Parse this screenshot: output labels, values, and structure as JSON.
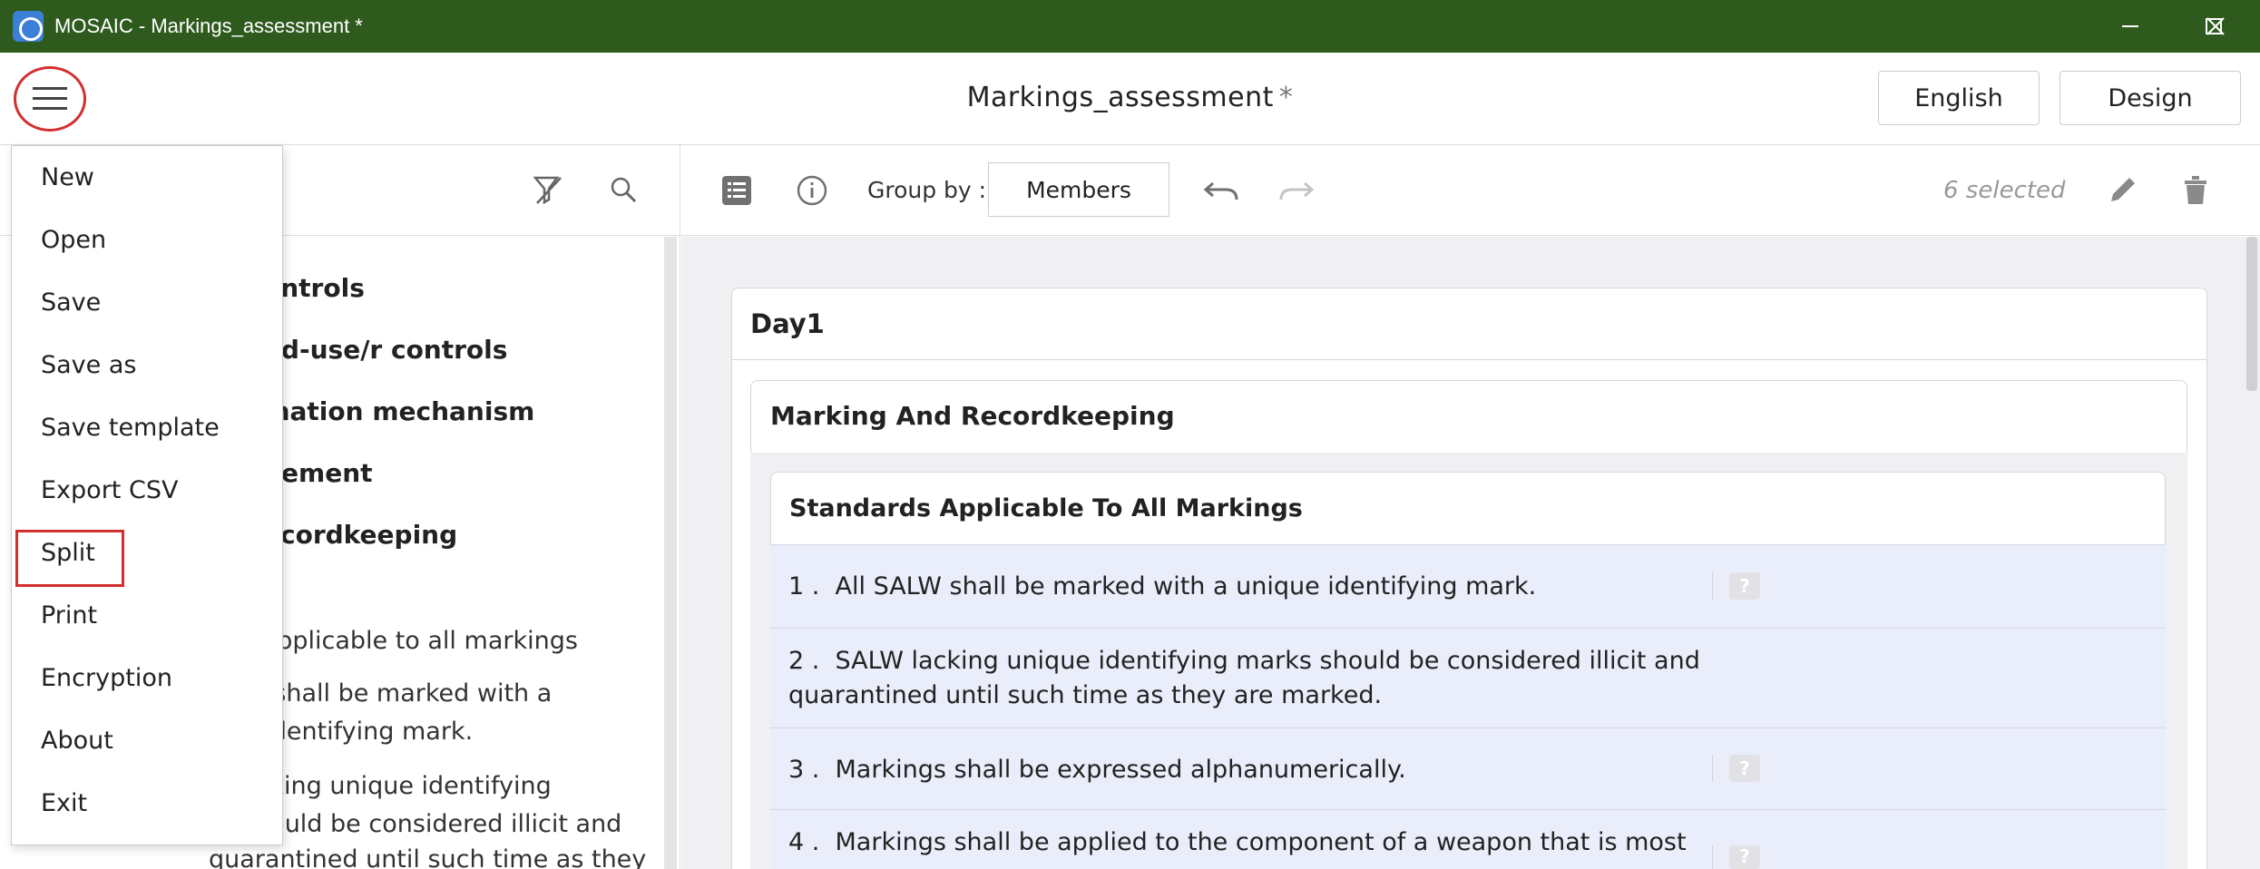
{
  "window": {
    "title": "MOSAIC - Markings_assessment *"
  },
  "header": {
    "title": "Markings_assessment",
    "modified_marker": "*",
    "language_button": "English",
    "design_button": "Design"
  },
  "menu": {
    "items": [
      "New",
      "Open",
      "Save",
      "Save as",
      "Save template",
      "Export CSV",
      "Split",
      "Print",
      "Encryption",
      "About",
      "Exit"
    ]
  },
  "tree": {
    "items": [
      "ontrols",
      "nd-use/r controls",
      "ination mechanism",
      "gement",
      "ecordkeeping"
    ],
    "texts": [
      "s applicable to all markings",
      "W shall be marked with a",
      "e identifying mark.",
      "acking unique identifying",
      "should be considered illicit and",
      "quarantined until such time as they"
    ]
  },
  "toolbar": {
    "group_by_label": "Group by :",
    "group_by_value": "Members",
    "selected_count": "6 selected"
  },
  "content": {
    "day_title": "Day1",
    "section_title": "Marking And Recordkeeping",
    "subsection_title": "Standards Applicable To All Markings",
    "help_glyph": "?",
    "rows": [
      {
        "num": "1 .",
        "line1": "All SALW shall be marked with a unique identifying mark.",
        "line2": ""
      },
      {
        "num": "2 .",
        "line1": "SALW lacking unique identifying marks should be considered illicit and",
        "line2": "quarantined until such time as they are marked."
      },
      {
        "num": "3 .",
        "line1": "Markings shall be expressed alphanumerically.",
        "line2": ""
      },
      {
        "num": "4 .",
        "line1": "Markings shall be applied to the component of a weapon that is most",
        "line2": ""
      }
    ]
  }
}
